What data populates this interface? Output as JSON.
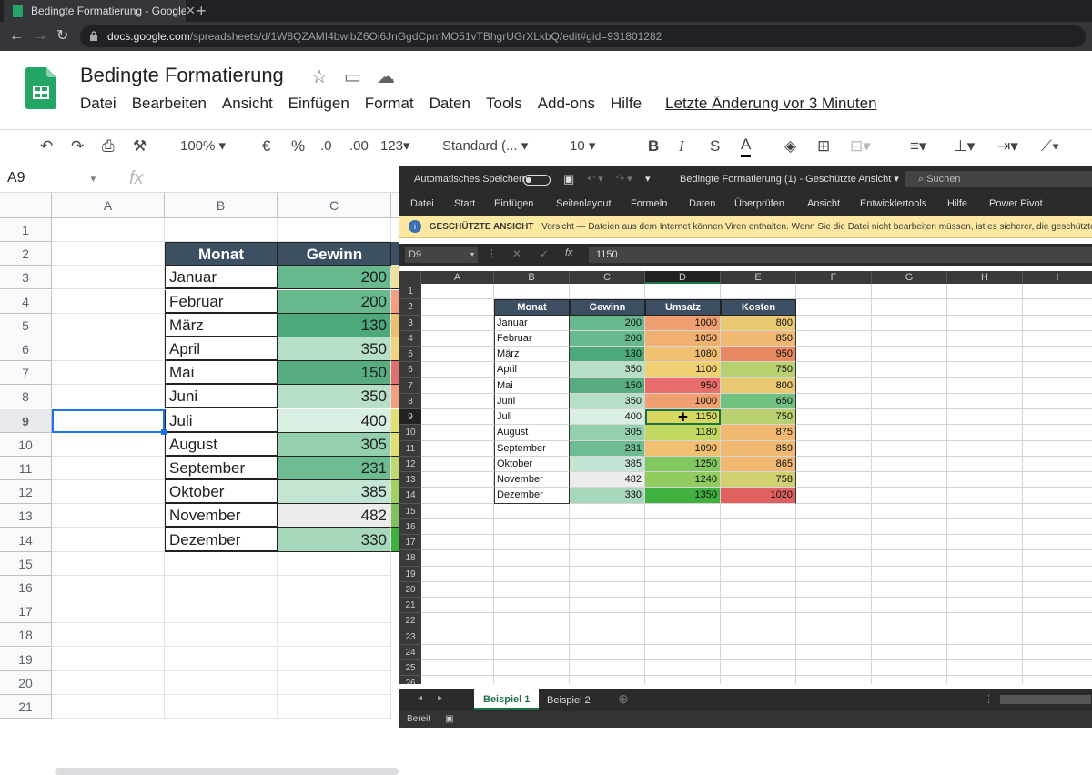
{
  "browser": {
    "tab_title": "Bedingte Formatierung - Google",
    "url_host": "docs.google.com",
    "url_path": "/spreadsheets/d/1W8QZAMI4bwibZ6Oi6JnGgdCpmMO51vTBhgrUGrXLkbQ/edit#gid=931801282"
  },
  "sheets": {
    "title": "Bedingte Formatierung",
    "menu": [
      "Datei",
      "Bearbeiten",
      "Ansicht",
      "Einfügen",
      "Format",
      "Daten",
      "Tools",
      "Add-ons",
      "Hilfe"
    ],
    "last_edit": "Letzte Änderung vor 3 Minuten",
    "toolbar": {
      "zoom": "100%",
      "currency": "€",
      "percent": "%",
      "dec_less": ".0",
      "dec_more": ".00",
      "format_more": "123",
      "font": "Standard (...",
      "font_size": "10",
      "bold": "B",
      "italic": "I",
      "strike": "S",
      "text_color": "A"
    },
    "name_box": "A9",
    "fx": "fx",
    "columns": [
      "A",
      "B",
      "C"
    ],
    "rows": [
      "1",
      "2",
      "3",
      "4",
      "5",
      "6",
      "7",
      "8",
      "9",
      "10",
      "11",
      "12",
      "13",
      "14",
      "15",
      "16",
      "17",
      "18",
      "19",
      "20",
      "21"
    ],
    "header": {
      "month": "Monat",
      "profit": "Gewinn"
    },
    "months": [
      "Januar",
      "Februar",
      "März",
      "April",
      "Mai",
      "Juni",
      "Juli",
      "August",
      "September",
      "Oktober",
      "November",
      "Dezember"
    ],
    "profits": [
      "200",
      "200",
      "130",
      "350",
      "150",
      "350",
      "400",
      "305",
      "231",
      "385",
      "482",
      "330"
    ],
    "profit_colors": [
      "#69b98e",
      "#69b98e",
      "#4da979",
      "#b7dfc7",
      "#58ad80",
      "#b7dfc7",
      "#d9efe2",
      "#94cfae",
      "#6dbb91",
      "#c4e5d1",
      "#ececec",
      "#a8d8bb"
    ],
    "right_edge_colors": [
      "#f0e0a0",
      "#f0a080",
      "#e8c070",
      "#f0d480",
      "#e07070",
      "#f0a080",
      "#e0e070",
      "#e0e070",
      "#c0d870",
      "#a0d060",
      "#80c060",
      "#40b040"
    ]
  },
  "excel": {
    "autosave": "Automatisches Speichern",
    "title": "Bedingte Formatierung (1)  -  Geschützte Ansicht",
    "search": "Suchen",
    "ribbon": [
      "Datei",
      "Start",
      "Einfügen",
      "Seitenlayout",
      "Formeln",
      "Daten",
      "Überprüfen",
      "Ansicht",
      "Entwicklertools",
      "Hilfe",
      "Power Pivot"
    ],
    "warn_title": "GESCHÜTZTE ANSICHT",
    "warn_text": "Vorsicht — Dateien aus dem Internet können Viren enthalten. Wenn Sie die Datei nicht bearbeiten müssen, ist es sicherer, die geschützte Ansicht",
    "name_box": "D9",
    "formula": "1150",
    "columns": [
      "A",
      "B",
      "C",
      "D",
      "E",
      "F",
      "G",
      "H",
      "I"
    ],
    "rows": [
      "1",
      "2",
      "3",
      "4",
      "5",
      "6",
      "7",
      "8",
      "9",
      "10",
      "11",
      "12",
      "13",
      "14",
      "15",
      "16",
      "17",
      "18",
      "19",
      "20",
      "21",
      "22",
      "23",
      "24",
      "25",
      "26"
    ],
    "header": {
      "month": "Monat",
      "profit": "Gewinn",
      "revenue": "Umsatz",
      "costs": "Kosten"
    },
    "months": [
      "Januar",
      "Februar",
      "März",
      "April",
      "Mai",
      "Juni",
      "Juli",
      "August",
      "September",
      "Oktober",
      "November",
      "Dezember"
    ],
    "profits": [
      "200",
      "200",
      "130",
      "350",
      "150",
      "350",
      "400",
      "305",
      "231",
      "385",
      "482",
      "330"
    ],
    "revenues": [
      "1000",
      "1050",
      "1080",
      "1100",
      "950",
      "1000",
      "1150",
      "1180",
      "1090",
      "1250",
      "1240",
      "1350"
    ],
    "costs": [
      "800",
      "850",
      "950",
      "750",
      "800",
      "650",
      "750",
      "875",
      "859",
      "865",
      "758",
      "1020"
    ],
    "profit_colors": [
      "#69b98e",
      "#69b98e",
      "#4da979",
      "#b7dfc7",
      "#58ad80",
      "#b7dfc7",
      "#d9efe2",
      "#94cfae",
      "#6dbb91",
      "#c4e5d1",
      "#ececec",
      "#a8d8bb"
    ],
    "revenue_colors": [
      "#f0a070",
      "#f0b070",
      "#f0c070",
      "#f0d070",
      "#e86c6c",
      "#f0a070",
      "#d8d860",
      "#c0d860",
      "#f0c070",
      "#80c860",
      "#90cc60",
      "#40b040"
    ],
    "cost_colors": [
      "#e8c870",
      "#f0b870",
      "#e88860",
      "#b8d070",
      "#e8c870",
      "#70c080",
      "#b8d070",
      "#f0b870",
      "#f0b870",
      "#f0b870",
      "#d0d070",
      "#e06060"
    ],
    "sheet_tabs": [
      "Beispiel 1",
      "Beispiel 2"
    ],
    "status": "Bereit"
  }
}
